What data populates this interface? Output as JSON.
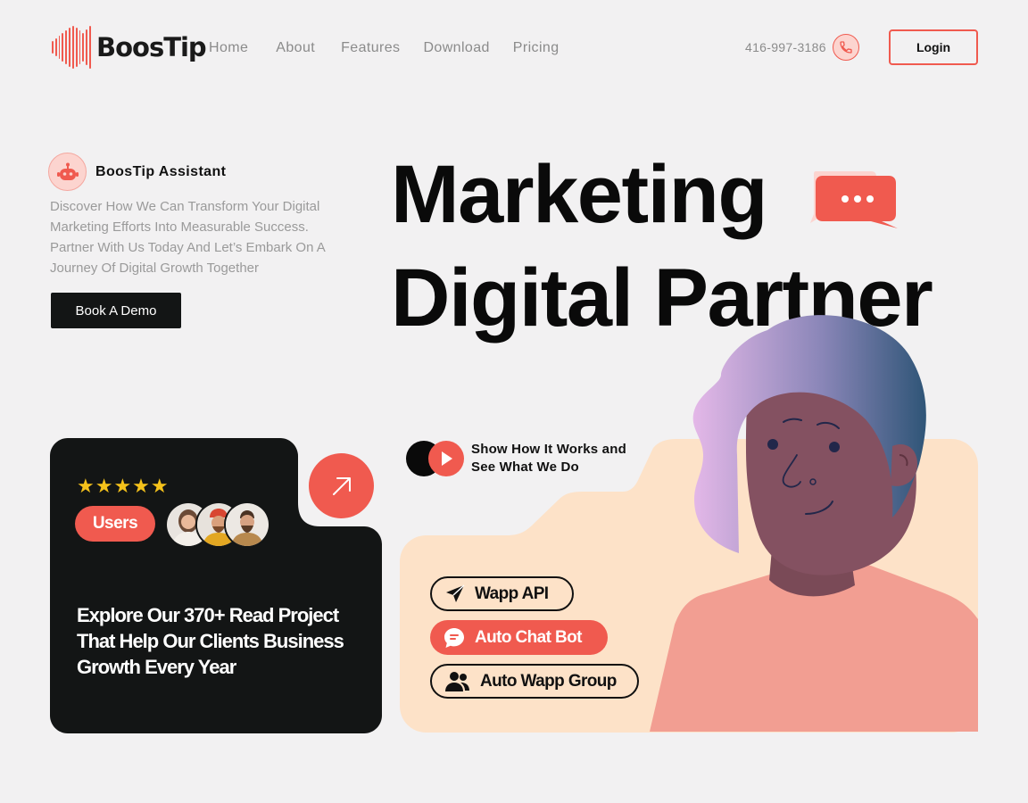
{
  "brand": {
    "name": "BoosTip"
  },
  "nav": {
    "items": [
      "Home",
      "About",
      "Features",
      "Download",
      "Pricing"
    ]
  },
  "header": {
    "phone": "416-997-3186",
    "login_label": "Login"
  },
  "hero": {
    "assistant_title": "BoosTip Assistant",
    "description": "Discover How We Can Transform Your Digital Marketing Efforts Into Measurable Success. Partner With Us Today And Let’s Embark On A Journey Of Digital Growth Together",
    "cta_label": "Book A Demo",
    "headline_line1": "Marketing",
    "headline_line2": "Digital Partner"
  },
  "stats_card": {
    "rating_stars": "★★★★★",
    "users_label": "Users",
    "text": "Explore Our 370+ Read Project That Help Our Clients Business Growth Every Year"
  },
  "feature_card": {
    "show_line1": "Show How It Works and",
    "show_line2": "See What We Do",
    "pills": [
      "Wapp API",
      "Auto Chat Bot",
      "Auto Wapp Group"
    ]
  },
  "colors": {
    "accent": "#f05a4f",
    "dark": "#131515",
    "peach": "#fde2c8",
    "background": "#f2f1f2",
    "star": "#f5c21b"
  },
  "icons": [
    "logo-wave-icon",
    "phone-icon",
    "robot-icon",
    "chat-bubble-icon",
    "star-icon",
    "arrow-up-right-icon",
    "play-icon",
    "send-icon",
    "chat-icon",
    "group-icon"
  ]
}
